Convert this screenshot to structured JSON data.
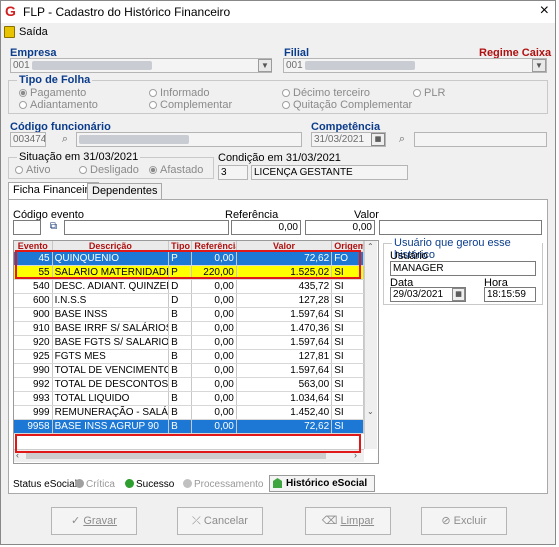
{
  "window": {
    "title": "FLP - Cadastro do Histórico Financeiro",
    "close": "×"
  },
  "menu": {
    "saida": "Saída"
  },
  "empresa": {
    "label": "Empresa",
    "value": "001"
  },
  "filial": {
    "label": "Filial",
    "value": "001",
    "regime": "Regime Caixa"
  },
  "tipo_folha": {
    "title": "Tipo de Folha",
    "options": [
      "Pagamento",
      "Informado",
      "Décimo terceiro",
      "PLR",
      "Adiantamento",
      "Complementar",
      "Quitação Complementar"
    ]
  },
  "codigo_funcionario": {
    "label": "Código funcionário",
    "value": "003474"
  },
  "competencia": {
    "label": "Competência",
    "value": "31/03/2021"
  },
  "situacao": {
    "title": "Situação em 31/03/2021",
    "options": [
      "Ativo",
      "Desligado",
      "Afastado"
    ]
  },
  "condicao": {
    "title": "Condição em 31/03/2021",
    "code": "3",
    "desc": "LICENÇA GESTANTE"
  },
  "tabs": {
    "ficha": "Ficha Financeira",
    "dependentes": "Dependentes"
  },
  "evento_fields": {
    "codigo_label": "Código evento",
    "referencia_label": "Referência",
    "referencia_value": "0,00",
    "valor_label": "Valor",
    "valor_value": "0,00"
  },
  "grid": {
    "headers": [
      "Evento",
      "Descrição",
      "Tipo",
      "Referência",
      "Valor",
      "Origem"
    ],
    "rows": [
      {
        "evento": "45",
        "descricao": "QUINQUENIO",
        "tipo": "P",
        "referencia": "0,00",
        "valor": "72,62",
        "origem": "FO"
      },
      {
        "evento": "55",
        "descricao": "SALARIO MATERNIDADE",
        "tipo": "P",
        "referencia": "220,00",
        "valor": "1.525,02",
        "origem": "SI"
      },
      {
        "evento": "540",
        "descricao": "DESC. ADIANT. QUINZEN",
        "tipo": "D",
        "referencia": "0,00",
        "valor": "435,72",
        "origem": "SI"
      },
      {
        "evento": "600",
        "descricao": "I.N.S.S",
        "tipo": "D",
        "referencia": "0,00",
        "valor": "127,28",
        "origem": "SI"
      },
      {
        "evento": "900",
        "descricao": "BASE INSS",
        "tipo": "B",
        "referencia": "0,00",
        "valor": "1.597,64",
        "origem": "SI"
      },
      {
        "evento": "910",
        "descricao": "BASE IRRF S/ SALÁRIOS",
        "tipo": "B",
        "referencia": "0,00",
        "valor": "1.470,36",
        "origem": "SI"
      },
      {
        "evento": "920",
        "descricao": "BASE FGTS S/ SALARIO",
        "tipo": "B",
        "referencia": "0,00",
        "valor": "1.597,64",
        "origem": "SI"
      },
      {
        "evento": "925",
        "descricao": "FGTS MES",
        "tipo": "B",
        "referencia": "0,00",
        "valor": "127,81",
        "origem": "SI"
      },
      {
        "evento": "990",
        "descricao": "TOTAL DE VENCIMENTOS",
        "tipo": "B",
        "referencia": "0,00",
        "valor": "1.597,64",
        "origem": "SI"
      },
      {
        "evento": "992",
        "descricao": "TOTAL DE DESCONTOS",
        "tipo": "B",
        "referencia": "0,00",
        "valor": "563,00",
        "origem": "SI"
      },
      {
        "evento": "993",
        "descricao": "TOTAL LIQUIDO",
        "tipo": "B",
        "referencia": "0,00",
        "valor": "1.034,64",
        "origem": "SI"
      },
      {
        "evento": "999",
        "descricao": "REMUNERAÇÃO - SALÁ...",
        "tipo": "B",
        "referencia": "0,00",
        "valor": "1.452,40",
        "origem": "SI"
      },
      {
        "evento": "9958",
        "descricao": "BASE INSS AGRUP 90",
        "tipo": "B",
        "referencia": "0,00",
        "valor": "72,62",
        "origem": "SI"
      }
    ]
  },
  "historico_usuario": {
    "title": "Usuário que gerou esse histórico",
    "usuario_label": "Usuário",
    "usuario_value": "MANAGER",
    "data_label": "Data",
    "data_value": "29/03/2021",
    "hora_label": "Hora",
    "hora_value": "18:15:59"
  },
  "status_esocial": {
    "label": "Status eSocial:",
    "critica": "Crítica",
    "sucesso": "Sucesso",
    "processamento": "Processamento",
    "historico_btn": "Histórico eSocial",
    "colors": {
      "critica": "#a0a0a0",
      "sucesso": "#2e9e2e",
      "processamento": "#c0c0c0"
    }
  },
  "buttons": {
    "gravar": "Gravar",
    "cancelar": "Cancelar",
    "limpar": "Limpar",
    "excluir": "Excluir"
  }
}
